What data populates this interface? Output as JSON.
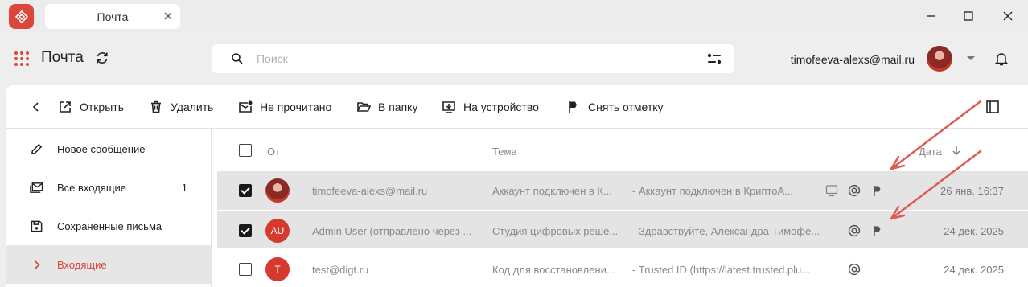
{
  "window": {
    "tab_title": "Почта"
  },
  "header": {
    "title": "Почта",
    "search_placeholder": "Поиск",
    "user_email": "timofeeva-alexs@mail.ru"
  },
  "toolbar": {
    "open": "Открыть",
    "delete": "Удалить",
    "unread": "Не прочитано",
    "to_folder": "В папку",
    "to_device": "На устройство",
    "unflag": "Снять отметку"
  },
  "sidebar": {
    "items": [
      {
        "label": "Новое сообщение",
        "count": ""
      },
      {
        "label": "Все входящие",
        "count": "1"
      },
      {
        "label": "Сохранённые письма",
        "count": ""
      },
      {
        "label": "Входящие",
        "count": ""
      }
    ]
  },
  "list": {
    "columns": {
      "from": "От",
      "subject": "Тема",
      "date": "Дата"
    },
    "rows": [
      {
        "from": "timofeeva-alexs@mail.ru",
        "subject": "Аккаунт подключен в К...",
        "preview": "- Аккаунт подключен в КриптоА...",
        "date": "26 янв. 16:37",
        "avatar": "",
        "checked": true
      },
      {
        "from": "Admin User (отправлено через ...",
        "subject": "Студия цифровых реше...",
        "preview": "- Здравствуйте, Александра Тимофе...",
        "date": "24 дек. 2025",
        "avatar": "AU",
        "checked": true
      },
      {
        "from": "test@digt.ru",
        "subject": "Код для восстановлени...",
        "preview": "-  Trusted ID (https://latest.trusted.plu...",
        "date": "24 дек. 2025",
        "avatar": "T",
        "checked": false
      }
    ]
  },
  "colors": {
    "accent": "#d9483b",
    "annotation": "#e05a55"
  }
}
